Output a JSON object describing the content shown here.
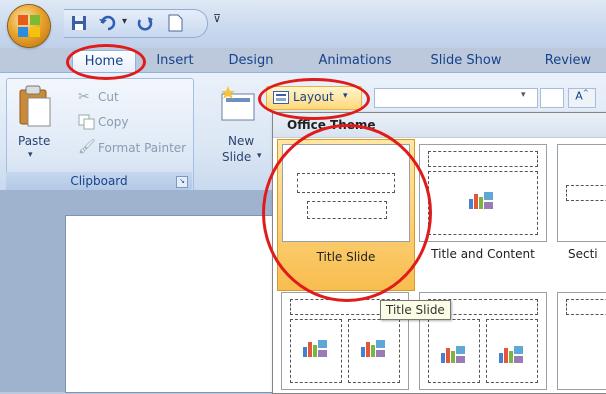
{
  "tabs": [
    {
      "id": "home",
      "label": "Home"
    },
    {
      "id": "insert",
      "label": "Insert"
    },
    {
      "id": "design",
      "label": "Design"
    },
    {
      "id": "animations",
      "label": "Animations"
    },
    {
      "id": "slideshow",
      "label": "Slide Show"
    },
    {
      "id": "review",
      "label": "Review"
    }
  ],
  "clipboard": {
    "paste": "Paste",
    "cut": "Cut",
    "copy": "Copy",
    "format_painter": "Format Painter",
    "group_label": "Clipboard"
  },
  "slides": {
    "new_slide_line1": "New",
    "new_slide_line2": "Slide",
    "layout": "Layout"
  },
  "layout_gallery": {
    "header": "Office Theme",
    "items": [
      {
        "label": "Title Slide",
        "selected": true
      },
      {
        "label": "Title and Content",
        "selected": false
      },
      {
        "label": "Secti",
        "selected": false
      }
    ]
  },
  "tooltip": "Title Slide",
  "colors": {
    "annotation": "#e01b1b",
    "selection": "#f8bd4f",
    "ribbon_text": "#15428b"
  }
}
